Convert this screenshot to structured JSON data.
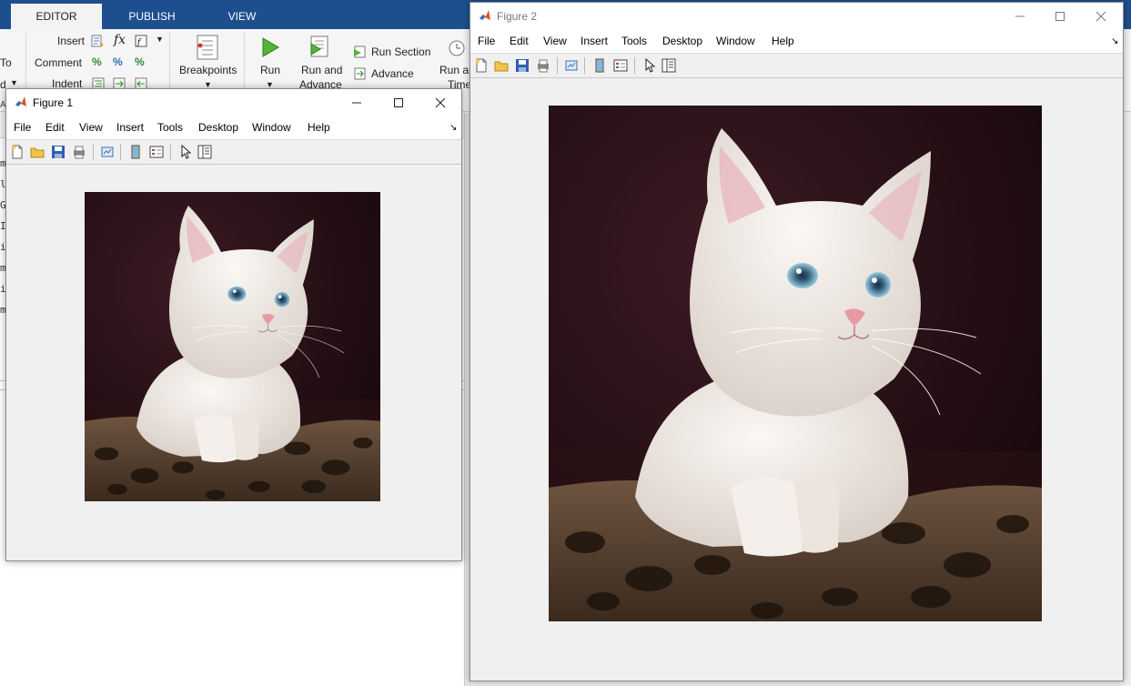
{
  "ribbon": {
    "tabs": [
      "EDITOR",
      "PUBLISH",
      "VIEW"
    ],
    "insert_label": "Insert",
    "fx_label": "fx",
    "comment_label": "Comment",
    "indent_label": "Indent",
    "breakpoints_label": "Breakpoints",
    "run_label": "Run",
    "run_and_advance_line1": "Run and",
    "run_and_advance_line2": "Advance",
    "run_section_label": "Run Section",
    "advance_label": "Advance",
    "run_and_time_line1": "Run ar",
    "run_and_time_line2": "Time",
    "left_cut_1": "To",
    "left_cut_2": "d",
    "left_cut_3": "AT"
  },
  "editor": {
    "gutter_chars": [
      "m",
      "l",
      "G",
      "I",
      "i",
      "m",
      "i",
      "m"
    ]
  },
  "figure1": {
    "title": "Figure 1",
    "menus": [
      "File",
      "Edit",
      "View",
      "Insert",
      "Tools",
      "Desktop",
      "Window",
      "Help"
    ]
  },
  "figure2": {
    "title": "Figure 2",
    "menus": [
      "File",
      "Edit",
      "View",
      "Insert",
      "Tools",
      "Desktop",
      "Window",
      "Help"
    ]
  },
  "toolbar_icons": [
    "new-figure-icon",
    "open-file-icon",
    "save-icon",
    "print-icon",
    "link-plot-icon",
    "colorbar-icon",
    "legend-icon",
    "pointer-icon",
    "property-inspector-icon"
  ],
  "colors": {
    "tab_strip": "#1d4f8f",
    "window_bg": "#f0f0f0",
    "image_bg": "#1a0c10",
    "fur_base": "#5b4330"
  }
}
